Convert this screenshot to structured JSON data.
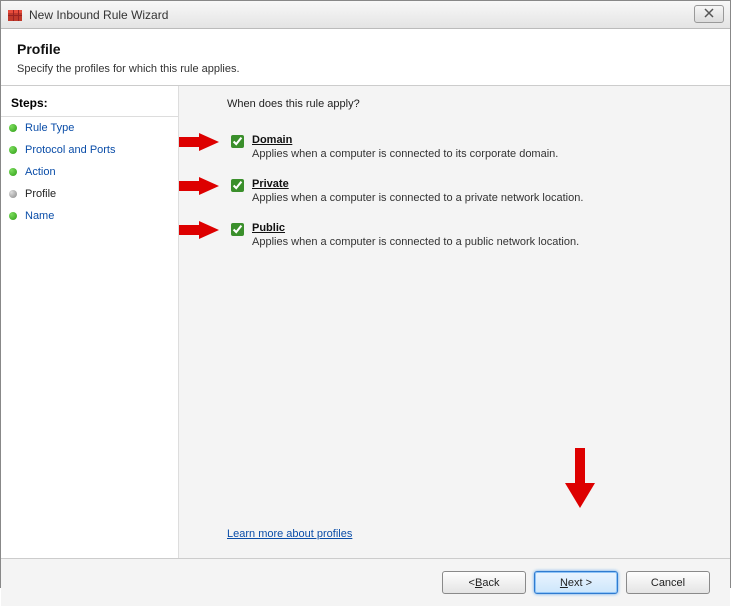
{
  "window": {
    "title": "New Inbound Rule Wizard"
  },
  "header": {
    "title": "Profile",
    "subtitle": "Specify the profiles for which this rule applies."
  },
  "sidebar": {
    "label": "Steps:",
    "items": [
      {
        "label": "Rule Type",
        "current": false
      },
      {
        "label": "Protocol and Ports",
        "current": false
      },
      {
        "label": "Action",
        "current": false
      },
      {
        "label": "Profile",
        "current": true
      },
      {
        "label": "Name",
        "current": false
      }
    ]
  },
  "content": {
    "question": "When does this rule apply?",
    "options": [
      {
        "name": "Domain",
        "checked": true,
        "desc": "Applies when a computer is connected to its corporate domain."
      },
      {
        "name": "Private",
        "checked": true,
        "desc": "Applies when a computer is connected to a private network location."
      },
      {
        "name": "Public",
        "checked": true,
        "desc": "Applies when a computer is connected to a public network location."
      }
    ],
    "learn_link": "Learn more about profiles"
  },
  "footer": {
    "back_pre": "< ",
    "back_u": "B",
    "back_post": "ack",
    "next_u": "N",
    "next_post": "ext >",
    "cancel": "Cancel"
  }
}
